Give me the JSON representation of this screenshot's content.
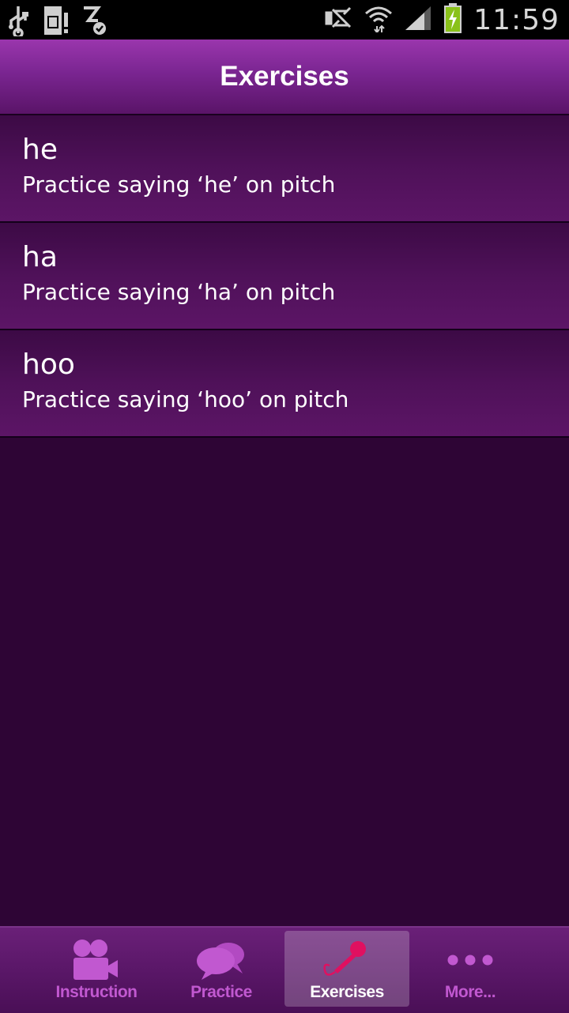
{
  "status_bar": {
    "time": "11:59",
    "icons": [
      "usb-icon",
      "sd-card-icon",
      "sync-icon",
      "mute-icon",
      "wifi-icon",
      "signal-icon",
      "battery-charging-icon"
    ]
  },
  "header": {
    "title": "Exercises"
  },
  "exercises": [
    {
      "title": "he",
      "subtitle": "Practice saying ‘he’ on pitch"
    },
    {
      "title": "ha",
      "subtitle": "Practice saying ‘ha’ on pitch"
    },
    {
      "title": "hoo",
      "subtitle": "Practice saying ‘hoo’ on pitch"
    }
  ],
  "tabs": [
    {
      "label": "Instruction",
      "icon": "video-camera-icon"
    },
    {
      "label": "Practice",
      "icon": "chat-bubbles-icon"
    },
    {
      "label": "Exercises",
      "icon": "microphone-icon",
      "selected": true
    },
    {
      "label": "More...",
      "icon": "more-dots-icon"
    }
  ],
  "colors": {
    "accent": "#c158d0",
    "background": "#2e0535",
    "header": "#8a2d9f",
    "microphone": "#e01060"
  }
}
